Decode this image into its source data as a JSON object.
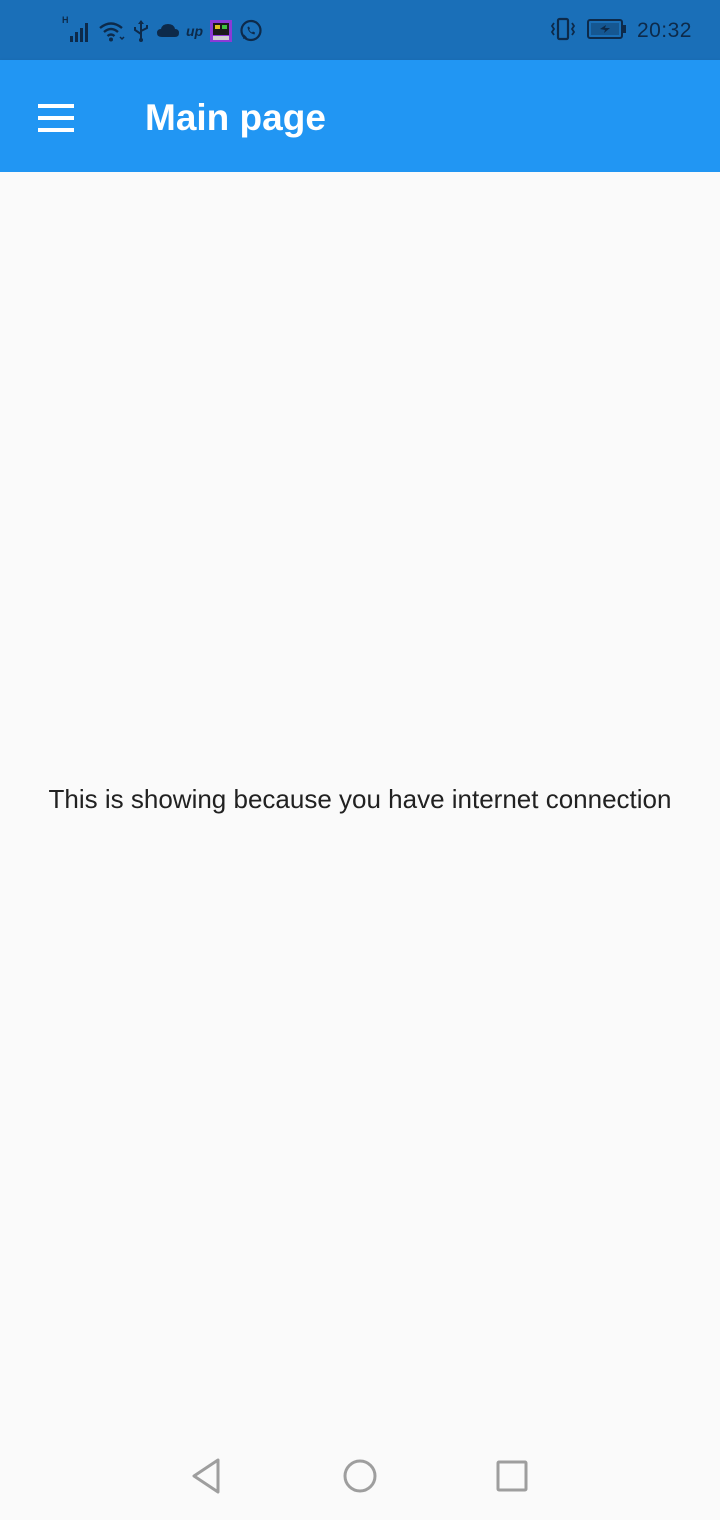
{
  "status_bar": {
    "time": "20:32",
    "network_label": "H",
    "upwork_label": "up",
    "icons": [
      "signal-icon",
      "wifi-icon",
      "usb-icon",
      "cloud-icon",
      "upwork-icon",
      "app-notification-icon",
      "whatsapp-icon",
      "vibrate-icon",
      "battery-icon"
    ]
  },
  "app_bar": {
    "title": "Main page",
    "menu_icon": "hamburger-menu-icon"
  },
  "main": {
    "message": "This is showing because you have internet connection"
  },
  "nav_bar": {
    "buttons": [
      "back-icon",
      "home-icon",
      "recents-icon"
    ]
  },
  "colors": {
    "status_bar": "#1a6fb8",
    "app_bar": "#2196f3",
    "background": "#fafafa",
    "text": "#212121"
  }
}
